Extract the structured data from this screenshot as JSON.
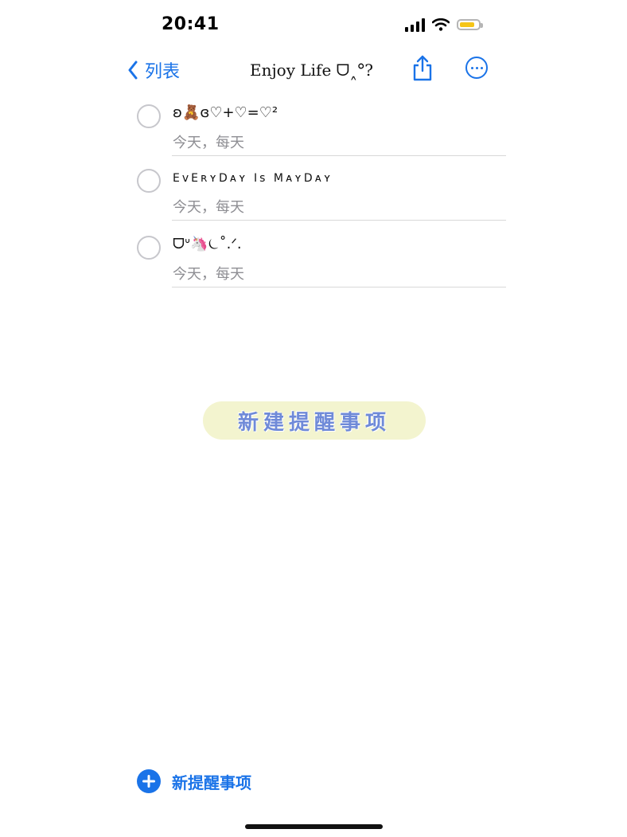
{
  "status_bar": {
    "time": "20:41",
    "icons": [
      "signal-icon",
      "wifi-icon",
      "battery-icon"
    ],
    "battery_color": "#f5c518"
  },
  "nav": {
    "back_label": "列表",
    "title": "Enjoy Life ᗜ˰ᐤ?",
    "share_icon": "share-icon",
    "more_icon": "ellipsis-circle-icon",
    "accent": "#1a73e8"
  },
  "reminders": [
    {
      "title": "ʚ🧸ɞ♡+♡=♡²",
      "subtitle": "今天，每天"
    },
    {
      "title": "EᴠEʀʏDᴀʏ Iѕ MᴀʏDᴀʏ",
      "subtitle": "今天，每天"
    },
    {
      "title": "ᗜᐡ🦄⏾˚.ᐟ.",
      "subtitle": "今天，每天"
    }
  ],
  "sticker_text": "新建提醒事项",
  "bottom": {
    "new_reminder_label": "新提醒事项"
  }
}
